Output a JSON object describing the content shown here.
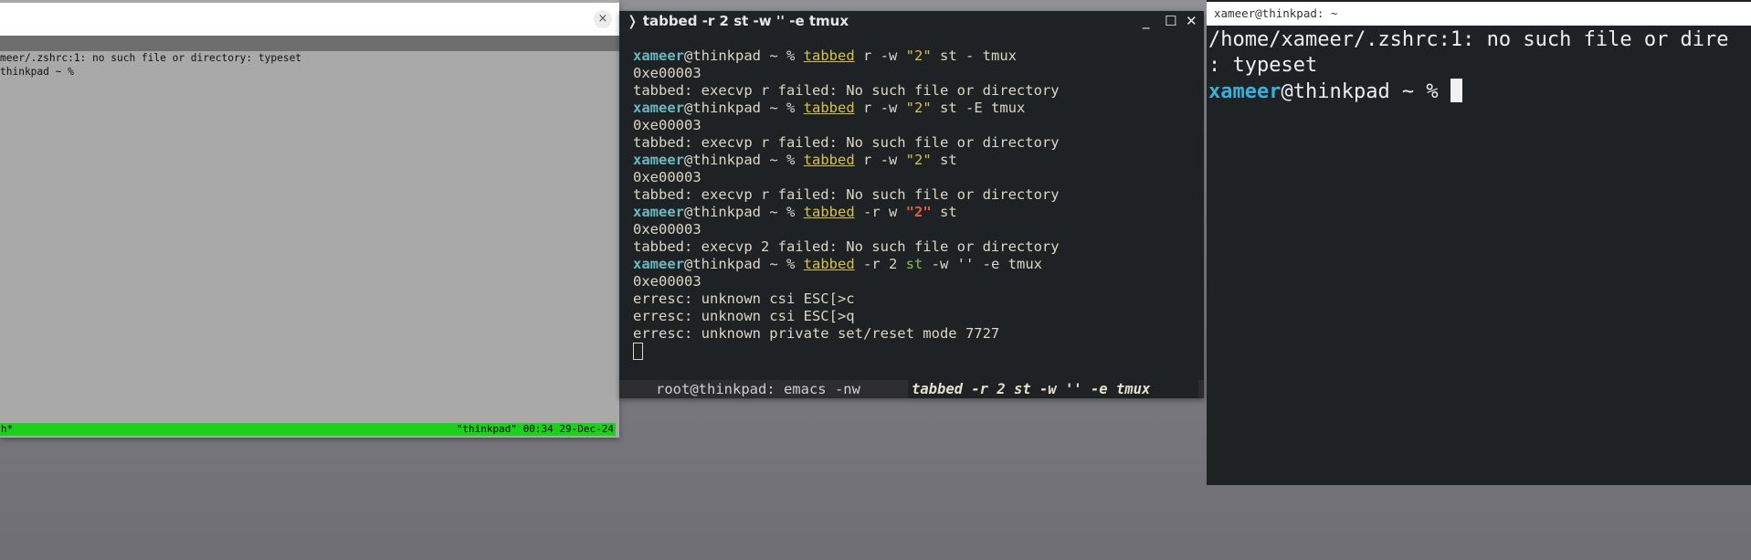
{
  "win1": {
    "close_glyph": "×",
    "lines": [
      "meer/.zshrc:1: no such file or directory: typeset",
      "thinkpad ~ %"
    ],
    "status_left": "h*",
    "status_right": "\"thinkpad\" 00:34 29-Dec-24"
  },
  "win2": {
    "title": "❭ tabbed -r 2 st -w '' -e tmux",
    "controls": {
      "minimize": "_",
      "maximize": "☐",
      "close": "✕"
    },
    "prompt_user": "xameer",
    "prompt_host": "@thinkpad ~ %",
    "cmd": "tabbed",
    "commands": [
      {
        "args_pre": " r -w ",
        "arg_str": "\"2\"",
        "args_post": " st - tmux",
        "output": [
          "0xe00003",
          "tabbed: execvp r failed: No such file or directory"
        ]
      },
      {
        "args_pre": " r -w ",
        "arg_str": "\"2\"",
        "args_post": " st -E tmux",
        "output": [
          "0xe00003",
          "tabbed: execvp r failed: No such file or directory"
        ]
      },
      {
        "args_pre": " r -w ",
        "arg_str": "\"2\"",
        "args_post": " st",
        "output": [
          "0xe00003",
          "tabbed: execvp r failed: No such file or directory"
        ]
      },
      {
        "args_pre": " -r w ",
        "arg_str": "\"2\"",
        "args_post": " st",
        "output": [
          "0xe00003",
          "tabbed: execvp 2 failed: No such file or directory"
        ]
      }
    ],
    "last_cmd": {
      "args_pre": " -r 2 ",
      "arg_st": "st",
      "args_post": " -w '' -e tmux"
    },
    "last_output": [
      "0xe00003",
      "erresc: unknown csi ESC[>c",
      "erresc: unknown csi ESC[>q",
      "erresc: unknown private set/reset mode 7727"
    ],
    "tabs": [
      {
        "label": "root@thinkpad: emacs -nw"
      },
      {
        "label": "tabbed -r 2 st -w '' -e tmux"
      }
    ]
  },
  "win3": {
    "title": "xameer@thinkpad: ~",
    "lines": [
      "/home/xameer/.zshrc:1: no such file or dire",
      ": typeset"
    ],
    "prompt_user": "xameer",
    "prompt_host": "@thinkpad ~ % "
  },
  "colors": {
    "desktop": "#7a7a80",
    "terminal_bg": "#1f2224",
    "prompt_user": "#6bb8c0",
    "command": "#d7c14a",
    "tmux_status": "#1bd11b"
  }
}
